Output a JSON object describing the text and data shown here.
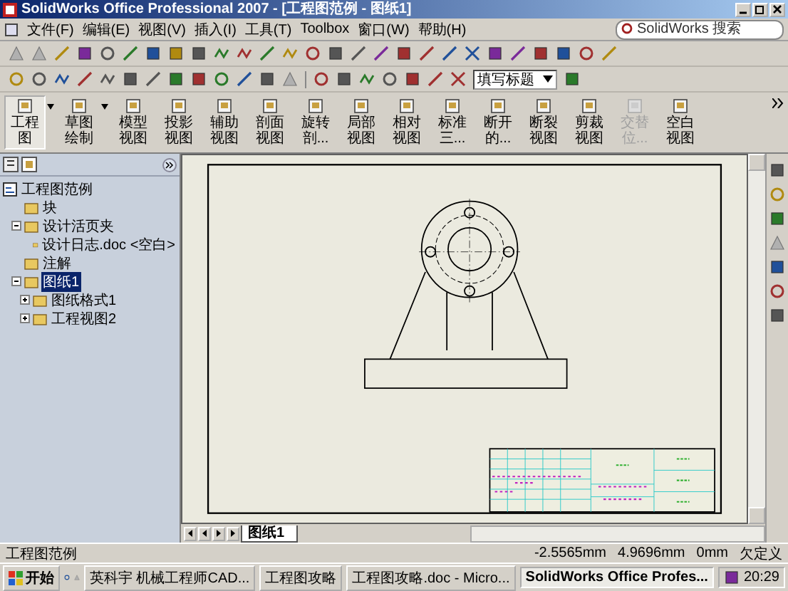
{
  "window": {
    "title": "SolidWorks Office Professional 2007 - [工程图范例 - 图纸1]"
  },
  "menu": [
    "文件(F)",
    "编辑(E)",
    "视图(V)",
    "插入(I)",
    "工具(T)",
    "Toolbox",
    "窗口(W)",
    "帮助(H)"
  ],
  "search": {
    "placeholder": "SolidWorks 搜索"
  },
  "style_dropdown": {
    "value": "填写标题"
  },
  "command_buttons": [
    {
      "label": "工程图",
      "selected": true,
      "dropdown": true,
      "disabled": false
    },
    {
      "label": "草图绘制",
      "selected": false,
      "dropdown": true,
      "disabled": false
    },
    {
      "label": "模型视图",
      "selected": false,
      "dropdown": false,
      "disabled": false
    },
    {
      "label": "投影视图",
      "selected": false,
      "dropdown": false,
      "disabled": false
    },
    {
      "label": "辅助视图",
      "selected": false,
      "dropdown": false,
      "disabled": false
    },
    {
      "label": "剖面视图",
      "selected": false,
      "dropdown": false,
      "disabled": false
    },
    {
      "label": "旋转剖...",
      "selected": false,
      "dropdown": false,
      "disabled": false
    },
    {
      "label": "局部视图",
      "selected": false,
      "dropdown": false,
      "disabled": false
    },
    {
      "label": "相对视图",
      "selected": false,
      "dropdown": false,
      "disabled": false
    },
    {
      "label": "标准三...",
      "selected": false,
      "dropdown": false,
      "disabled": false
    },
    {
      "label": "断开的...",
      "selected": false,
      "dropdown": false,
      "disabled": false
    },
    {
      "label": "断裂视图",
      "selected": false,
      "dropdown": false,
      "disabled": false
    },
    {
      "label": "剪裁视图",
      "selected": false,
      "dropdown": false,
      "disabled": false
    },
    {
      "label": "交替位...",
      "selected": false,
      "dropdown": false,
      "disabled": true
    },
    {
      "label": "空白视图",
      "selected": false,
      "dropdown": false,
      "disabled": false
    }
  ],
  "feature_tree": {
    "root": "工程图范例",
    "items": [
      {
        "label": "块",
        "selected": false
      },
      {
        "label": "设计活页夹",
        "selected": false,
        "expanded": true,
        "children": [
          {
            "label": "设计日志.doc <空白>",
            "selected": false
          }
        ]
      },
      {
        "label": "注解",
        "selected": false
      },
      {
        "label": "图纸1",
        "selected": true,
        "expanded": true,
        "children": [
          {
            "label": "图纸格式1",
            "selected": false,
            "expanded": false
          },
          {
            "label": "工程视图2",
            "selected": false,
            "expanded": false
          }
        ]
      }
    ]
  },
  "sheet_tabs": [
    {
      "label": "图纸1",
      "selected": true
    }
  ],
  "status_bar": {
    "document": "工程图范例",
    "x": "-2.5565mm",
    "y": "4.9696mm",
    "z": "0mm",
    "state": "欠定义"
  },
  "taskbar": {
    "start": "开始",
    "tasks": [
      {
        "label": "英科宇 机械工程师CAD...",
        "selected": false
      },
      {
        "label": "工程图攻略",
        "selected": false
      },
      {
        "label": "工程图攻略.doc - Micro...",
        "selected": false
      },
      {
        "label": "SolidWorks Office Profes...",
        "selected": true
      }
    ],
    "clock": "20:29"
  }
}
